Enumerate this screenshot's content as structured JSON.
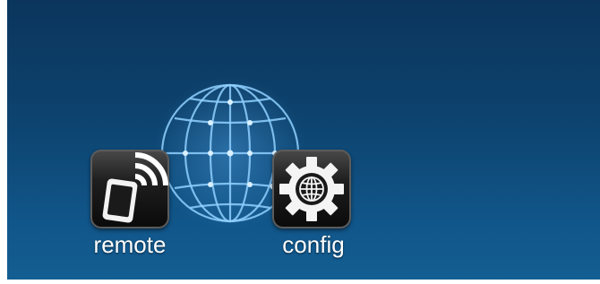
{
  "apps": [
    {
      "id": "remote",
      "label": "remote",
      "icon": "remote-control-icon"
    },
    {
      "id": "config",
      "label": "config",
      "icon": "gear-globe-icon"
    }
  ],
  "background_icon": "globe-icon",
  "colors": {
    "background_top": "#0b355c",
    "background_bottom": "#135e92",
    "globe_lines": "#8fd0ff",
    "label_text": "#ffffff"
  }
}
